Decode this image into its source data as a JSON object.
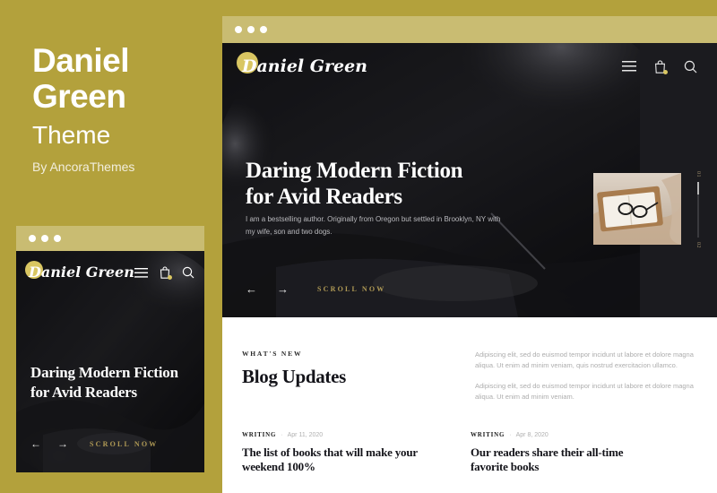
{
  "promo": {
    "title_line1": "Daniel",
    "title_line2": "Green",
    "subtitle": "Theme",
    "byline": "By AncoraThemes"
  },
  "colors": {
    "brand_gold": "#b3a13c",
    "chrome_gold": "#c9bc72",
    "logo_blob": "#d9c662",
    "hero_dark": "#0e0e11",
    "accent_text": "#b09a55"
  },
  "site": {
    "logo_text": "Daniel Green",
    "nav_icons": [
      {
        "name": "hamburger-menu-icon",
        "label": "Menu"
      },
      {
        "name": "shopping-bag-icon",
        "label": "Cart"
      },
      {
        "name": "search-icon",
        "label": "Search"
      }
    ]
  },
  "hero": {
    "title_line1": "Daring Modern Fiction",
    "title_line2": "for Avid Readers",
    "subtitle": "I am a bestselling author. Originally from Oregon but settled in Brooklyn, NY with my wife, son and two dogs.",
    "scroll_label": "SCROLL NOW",
    "prev_arrow": "←",
    "next_arrow": "→",
    "slide_current": "01",
    "slide_total": "02"
  },
  "blog": {
    "eyebrow": "WHAT'S NEW",
    "title": "Blog Updates",
    "paragraphs": [
      "Adipiscing elit, sed do euismod tempor incidunt ut labore et dolore magna aliqua. Ut enim ad minim veniam, quis nostrud exercitacion ullamco.",
      "Adipiscing elit, sed do euismod tempor incidunt ut labore et dolore magna aliqua. Ut enim ad minim veniam."
    ],
    "posts": [
      {
        "category": "WRITING",
        "separator": "·",
        "date": "Apr 11, 2020",
        "title": "The list of books that will make your weekend 100%"
      },
      {
        "category": "WRITING",
        "separator": "·",
        "date": "Apr 8, 2020",
        "title": "Our readers share their all-time favorite books"
      }
    ]
  }
}
